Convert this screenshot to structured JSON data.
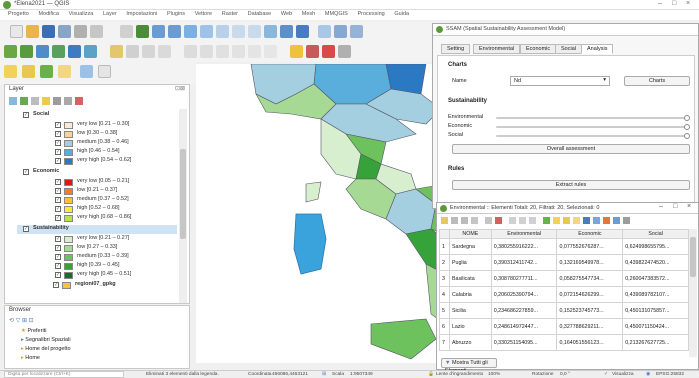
{
  "app": {
    "title": "*Elena2021 — QGIS"
  },
  "menu": [
    "Progetto",
    "Modifica",
    "Visualizza",
    "Layer",
    "Impostazioni",
    "Plugins",
    "Vettore",
    "Raster",
    "Database",
    "Web",
    "Mesh",
    "MMQGIS",
    "Processing",
    "Guida"
  ],
  "layers_panel": {
    "title": "Layer",
    "groups": [
      {
        "name": "Social",
        "classes": [
          {
            "label": "very low [0.21 – 0.30]",
            "color": "#fde9d4"
          },
          {
            "label": "low [0.30 – 0.38]",
            "color": "#f9d39f"
          },
          {
            "label": "medium [0.38 – 0.46]",
            "color": "#a3cfe0"
          },
          {
            "label": "high [0.46 – 0.54]",
            "color": "#5aaedb"
          },
          {
            "label": "very high [0.54 – 0.62]",
            "color": "#2b79c2"
          }
        ]
      },
      {
        "name": "Economic",
        "classes": [
          {
            "label": "very low [0.05 – 0.21]",
            "color": "#d7191c"
          },
          {
            "label": "low [0.21 – 0.37]",
            "color": "#f47d1e"
          },
          {
            "label": "medium [0.37 – 0.52]",
            "color": "#fdc239"
          },
          {
            "label": "high [0.52 – 0.68]",
            "color": "#f4ee3b"
          },
          {
            "label": "very high [0.68 – 0.86]",
            "color": "#b9e24d"
          }
        ]
      },
      {
        "name": "Sustainability",
        "classes": [
          {
            "label": "very low [0.21 – 0.27]",
            "color": "#d7eecf"
          },
          {
            "label": "low [0.27 – 0.33]",
            "color": "#a6d994"
          },
          {
            "label": "medium [0.33 – 0.39]",
            "color": "#6ec25e"
          },
          {
            "label": "high [0.39 – 0.45]",
            "color": "#36a33a"
          },
          {
            "label": "very high [0.45 – 0.51]",
            "color": "#12702a"
          }
        ]
      }
    ],
    "extra_layer": {
      "label": "regioni07_gpkg",
      "color": "#f3c43d"
    }
  },
  "browser_panel": {
    "title": "Browser",
    "items": [
      "Preferiti",
      "Segnalibri Spaziali",
      "Home del progetto",
      "Home"
    ]
  },
  "dialog": {
    "title": "SSAM (Spatial Sustainability Assessment Model)",
    "tabs": [
      "Setting",
      "Environmental",
      "Economic",
      "Social",
      "Analysis"
    ],
    "active_tab": "Analysis",
    "charts_section": "Charts",
    "name_label": "Name",
    "name_value": "Nd",
    "charts_button": "Charts",
    "sustainability_section": "Sustainability",
    "sliders": [
      "Environmental",
      "Economic",
      "Social"
    ],
    "overall_button": "Overall assessment",
    "rules_section": "Rules",
    "extract_button": "Extract rules"
  },
  "attribute_table": {
    "title": "Environmental :: Elementi Totali: 20, Filtrati: 20, Selezionati: 0",
    "columns": [
      "NOME",
      "Environmental",
      "Economic",
      "Social"
    ],
    "rows": [
      {
        "n": "1",
        "name": "Sardegna",
        "env": "0,380255916222...",
        "eco": "0,077552676287...",
        "soc": "0,624998655795..."
      },
      {
        "n": "2",
        "name": "Puglia",
        "env": "0,390312411742...",
        "eco": "0,132169549978...",
        "soc": "0,439822474520..."
      },
      {
        "n": "3",
        "name": "Basilicata",
        "env": "0,308780277711...",
        "eco": "0,058275547734...",
        "soc": "0,260047383572..."
      },
      {
        "n": "4",
        "name": "Calabria",
        "env": "0,206025390794...",
        "eco": "0,072154626299...",
        "soc": "0,439089782107..."
      },
      {
        "n": "5",
        "name": "Sicilia",
        "env": "0,234686227859...",
        "eco": "0,152523745773...",
        "soc": "0,450131075857..."
      },
      {
        "n": "6",
        "name": "Lazio",
        "env": "0,248614972447...",
        "eco": "0,327788629211...",
        "soc": "0,450071150424..."
      },
      {
        "n": "7",
        "name": "Abruzzo",
        "env": "0,330251154095...",
        "eco": "0,164051556123...",
        "soc": "0,213267627725..."
      }
    ],
    "footer_button": "Mostra Tutti gli Elementi"
  },
  "statusbar": {
    "locator": "Digita per localizzare (Ctrl+K)",
    "message": "Eliminati 3 elementi dalla legenda.",
    "coord_label": "Coordinata",
    "coord_value": "466086,4463121",
    "scale_label": "Scala",
    "scale_value": "1:9507349",
    "magnifier_label": "Lente d'ingrandimento",
    "magnifier_value": "100%",
    "rotation_label": "Rotazione",
    "rotation_value": "0,0 °",
    "render_label": "Visualizza",
    "crs": "EPSG:25832"
  }
}
